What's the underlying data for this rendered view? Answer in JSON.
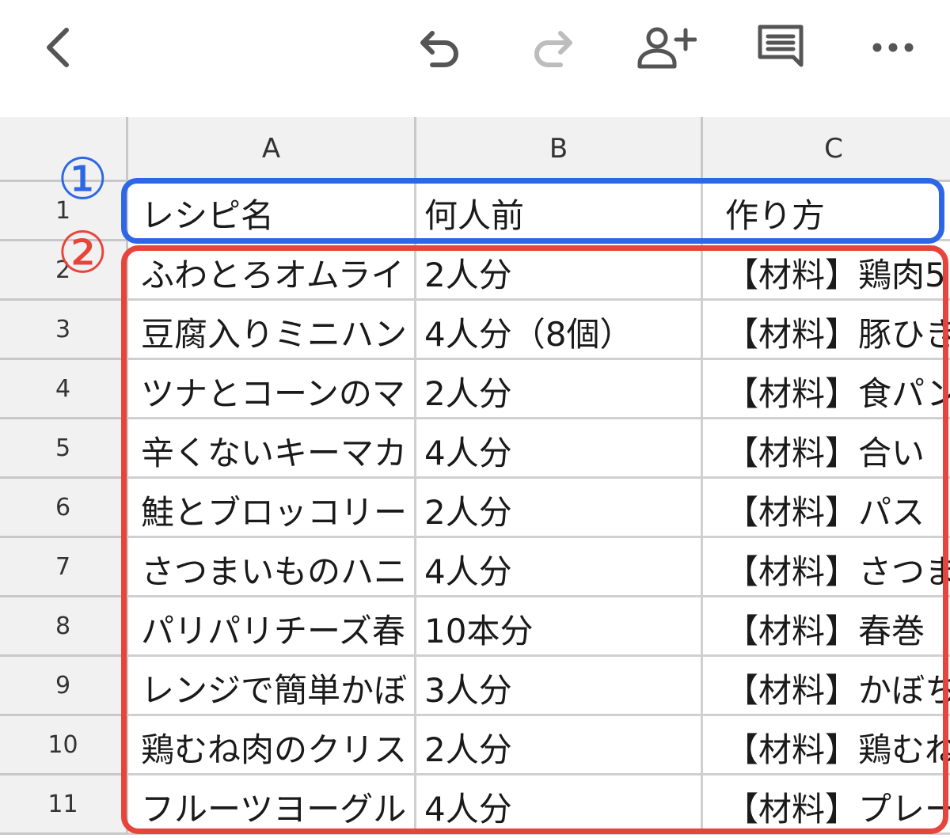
{
  "toolbar": {
    "icons": [
      "back-icon",
      "undo-icon",
      "redo-icon",
      "share-person-add-icon",
      "comment-icon",
      "more-icon"
    ],
    "colors": {
      "icon": "#555555",
      "disabled_icon": "#bdbdbd"
    }
  },
  "sheet": {
    "columns": [
      "A",
      "B",
      "C"
    ],
    "rows": [
      {
        "num": "1",
        "a": "レシピ名",
        "b": "何人前",
        "c": "作り方"
      },
      {
        "num": "2",
        "a": "ふわとろオムライ",
        "b": "2人分",
        "c": "【材料】鶏肉5"
      },
      {
        "num": "3",
        "a": "豆腐入りミニハン",
        "b": "4人分（8個）",
        "c": "【材料】豚ひき"
      },
      {
        "num": "4",
        "a": "ツナとコーンのマ",
        "b": "2人分",
        "c": "【材料】食パン"
      },
      {
        "num": "5",
        "a": "辛くないキーマカ",
        "b": "4人分",
        "c": "【材料】合い"
      },
      {
        "num": "6",
        "a": "鮭とブロッコリー",
        "b": "2人分",
        "c": "【材料】パス"
      },
      {
        "num": "7",
        "a": "さつまいものハニ",
        "b": "4人分",
        "c": "【材料】さつま"
      },
      {
        "num": "8",
        "a": "パリパリチーズ春",
        "b": "10本分",
        "c": "【材料】春巻"
      },
      {
        "num": "9",
        "a": "レンジで簡単かぼ",
        "b": "3人分",
        "c": "【材料】かぼち"
      },
      {
        "num": "10",
        "a": "鶏むね肉のクリス",
        "b": "2人分",
        "c": "【材料】鶏むね"
      },
      {
        "num": "11",
        "a": "フルーツヨーグル",
        "b": "4人分",
        "c": "【材料】プレー"
      }
    ]
  },
  "annotations": {
    "marker1": "①",
    "marker2": "②",
    "colors": {
      "blue": "#2e67e6",
      "red": "#e7453c"
    }
  }
}
